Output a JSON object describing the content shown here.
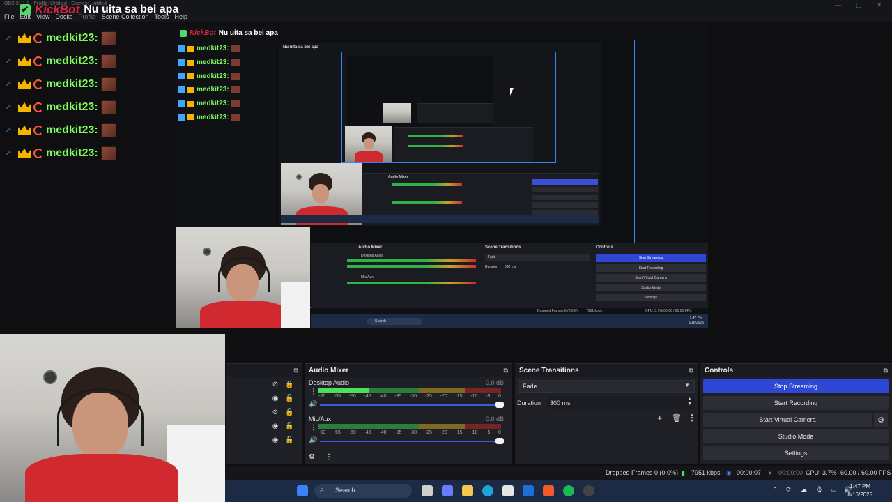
{
  "window": {
    "title_faint": "OBS 31.1.2 - Profile: Untitled - Scenes: Untitled",
    "menu": [
      {
        "label": "File",
        "dim": false
      },
      {
        "label": "Edit",
        "dim": false
      },
      {
        "label": "View",
        "dim": false
      },
      {
        "label": "Docks",
        "dim": false
      },
      {
        "label": "Profile",
        "dim": true
      },
      {
        "label": "Scene Collection",
        "dim": false
      },
      {
        "label": "Tools",
        "dim": false
      },
      {
        "label": "Help",
        "dim": false
      }
    ],
    "controls": {
      "minimize": "—",
      "maximize": "▢",
      "close": "✕"
    }
  },
  "overlay": {
    "brand": "KickBot",
    "message": "Nu uita sa bei apa",
    "check_glyph": "✔",
    "chat": [
      {
        "user": "medkit23:"
      },
      {
        "user": "medkit23:"
      },
      {
        "user": "medkit23:"
      },
      {
        "user": "medkit23:"
      },
      {
        "user": "medkit23:"
      },
      {
        "user": "medkit23:"
      }
    ],
    "colors": {
      "username": "#7cfc5a",
      "brand": "#d7263d",
      "sword": "#3ba7ff",
      "crown": "#f5b400"
    }
  },
  "preview_nested": {
    "brand": "KickBot",
    "message": "Nu uita sa bei apa",
    "chat_user": "medkit23:",
    "mini_message": "Nu uita sa bei apa",
    "panels": {
      "audio_mixer": "Audio Mixer",
      "scene_transitions": "Scene Transitions",
      "controls": "Controls",
      "desktop_audio": "Desktop Audio",
      "mic_aux": "Mic/Aux",
      "fade": "Fade",
      "duration_label": "Duration",
      "duration_value": "300 ms",
      "stop_streaming": "Stop Streaming",
      "start_recording": "Start Recording",
      "start_virtual_camera": "Start Virtual Camera",
      "studio_mode": "Studio Mode",
      "settings": "Settings",
      "status": "Dropped Frames 0 (0.0%)",
      "kbps": "7951 kbps",
      "cpu_fps": "CPU: 3.7%   60.00 / 60.00 FPS",
      "search": "Search",
      "time": "1:47 PM",
      "date": "8/16/2025",
      "db": "0.0 dB"
    }
  },
  "sources": {
    "rows": [
      {
        "visible_icon": "hidden-eye-icon",
        "lock_icon": "lock-icon"
      },
      {
        "visible_icon": "eye-icon",
        "lock_icon": "unlock-icon"
      },
      {
        "visible_icon": "hidden-eye-icon",
        "lock_icon": "unlock-icon"
      },
      {
        "visible_icon": "eye-icon",
        "lock_icon": "unlock-icon"
      },
      {
        "visible_icon": "eye-icon",
        "lock_icon": "unlock-icon"
      }
    ]
  },
  "audio_mixer": {
    "title": "Audio Mixer",
    "channels": [
      {
        "name": "Desktop Audio",
        "db": "0.0 dB",
        "level": 0.28
      },
      {
        "name": "Mic/Aux",
        "db": "0.0 dB",
        "level": 0
      }
    ],
    "scale": [
      "-60",
      "-55",
      "-50",
      "-45",
      "-40",
      "-35",
      "-30",
      "-25",
      "-20",
      "-15",
      "-10",
      "-5",
      "0"
    ]
  },
  "transitions": {
    "title": "Scene Transitions",
    "selected": "Fade",
    "duration_label": "Duration",
    "duration_value": "300 ms"
  },
  "controls": {
    "title": "Controls",
    "stop_streaming": "Stop Streaming",
    "start_recording": "Start Recording",
    "start_virtual_camera": "Start Virtual Camera",
    "studio_mode": "Studio Mode",
    "settings": "Settings"
  },
  "status": {
    "dropped": "Dropped Frames 0 (0.0%)",
    "kbps": "7951 kbps",
    "stream_time": "00:00:07",
    "rec_time": "00:00:00",
    "cpu": "CPU: 3.7%",
    "fps": "60.00 / 60.00 FPS"
  },
  "taskbar": {
    "search": "Search",
    "time": "1:47 PM",
    "date": "8/16/2025"
  }
}
